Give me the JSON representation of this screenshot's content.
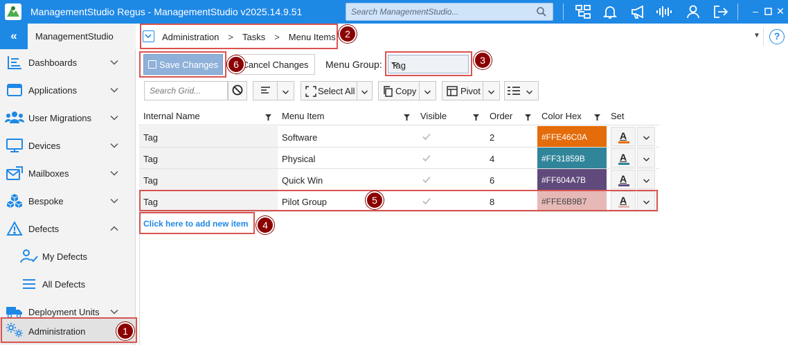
{
  "window": {
    "title": "ManagementStudio Regus - ManagementStudio v2025.14.9.51",
    "search_placeholder": "Search ManagementStudio...",
    "toolbar_icons": [
      "org-chart-icon",
      "bell-icon",
      "megaphone-icon",
      "audio-wave-icon",
      "user-icon",
      "logout-icon"
    ],
    "window_controls": [
      "minimize-icon",
      "maximize-icon",
      "close-icon"
    ]
  },
  "sidebar": {
    "app_name": "ManagementStudio",
    "collapse_label": "«",
    "items": [
      {
        "label": "Dashboards",
        "icon": "dashboard-icon",
        "expanded": false
      },
      {
        "label": "Applications",
        "icon": "applications-icon",
        "expanded": false
      },
      {
        "label": "User Migrations",
        "icon": "users-icon",
        "expanded": false
      },
      {
        "label": "Devices",
        "icon": "monitor-icon",
        "expanded": false
      },
      {
        "label": "Mailboxes",
        "icon": "mailbox-icon",
        "expanded": false
      },
      {
        "label": "Bespoke",
        "icon": "cubes-icon",
        "expanded": false
      },
      {
        "label": "Defects",
        "icon": "warning-icon",
        "expanded": true
      },
      {
        "label": "My Defects",
        "icon": "user-check-icon",
        "sub": true
      },
      {
        "label": "All Defects",
        "icon": "list-icon",
        "sub": true
      },
      {
        "label": "Deployment Units",
        "icon": "truck-icon",
        "expanded": false
      },
      {
        "label": "Administration",
        "icon": "gears-icon",
        "active": true
      }
    ]
  },
  "breadcrumb": {
    "items": [
      "Administration",
      "Tasks",
      "Menu Items"
    ],
    "help_label": "?"
  },
  "actions": {
    "save_label": "Save Changes",
    "cancel_label": "Cancel Changes",
    "menu_group_label": "Menu Group:",
    "menu_group_value": "Tag"
  },
  "grid_toolbar": {
    "search_placeholder": "Search Grid...",
    "select_all_label": "Select All",
    "copy_label": "Copy",
    "pivot_label": "Pivot"
  },
  "grid": {
    "columns": [
      "Internal Name",
      "Menu Item",
      "Visible",
      "Order",
      "Color Hex",
      "Set"
    ],
    "rows": [
      {
        "internal_name": "Tag",
        "menu_item": "Software",
        "visible": true,
        "order": "2",
        "color_hex": "#FFE46C0A",
        "color": "#e46c0a"
      },
      {
        "internal_name": "Tag",
        "menu_item": "Physical",
        "visible": true,
        "order": "4",
        "color_hex": "#FF31859B",
        "color": "#31859b"
      },
      {
        "internal_name": "Tag",
        "menu_item": "Quick Win",
        "visible": true,
        "order": "6",
        "color_hex": "#FF604A7B",
        "color": "#604a7b"
      },
      {
        "internal_name": "Tag",
        "menu_item": "Pilot Group",
        "visible": true,
        "order": "8",
        "color_hex": "#FFE6B9B7",
        "color": "#e6b9b7"
      }
    ],
    "add_new_label": "Click here to add new item"
  },
  "annotations": [
    "1",
    "2",
    "3",
    "4",
    "5",
    "6"
  ],
  "colors": {
    "accent": "#1e88e5",
    "annotation_border": "#d9534f",
    "annotation_badge": "#8b0000"
  }
}
